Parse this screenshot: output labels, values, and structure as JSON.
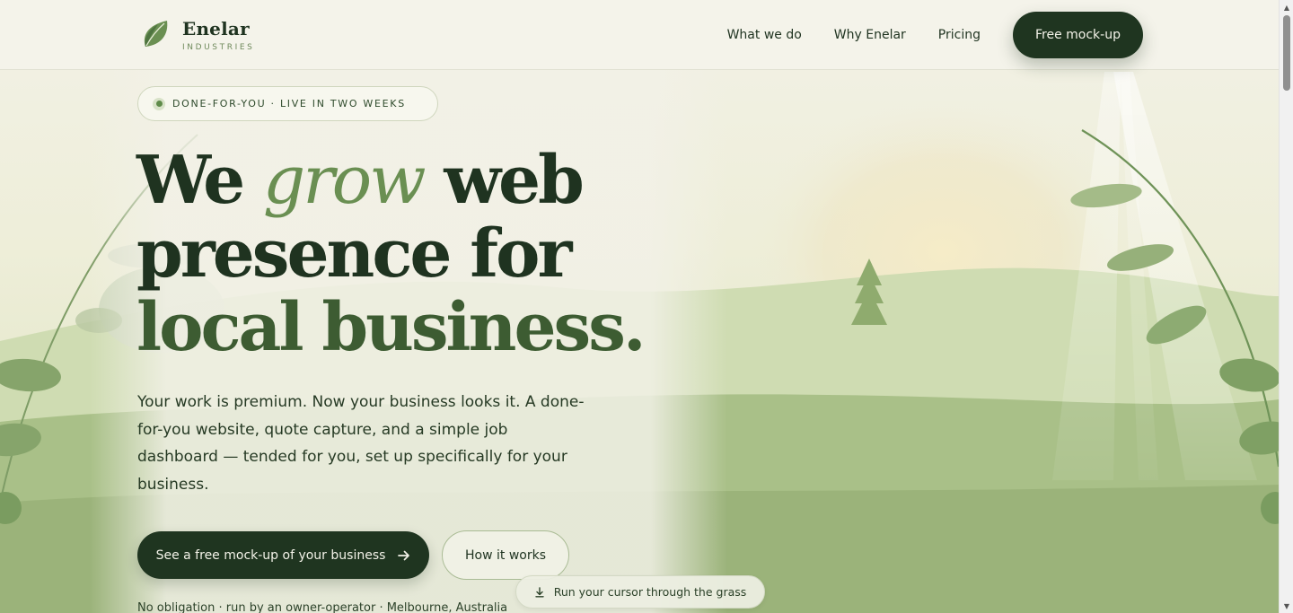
{
  "brand": {
    "name": "Enelar",
    "sub": "INDUSTRIES",
    "logo_icon": "leaf-icon"
  },
  "nav": {
    "links": [
      "What we do",
      "Why Enelar",
      "Pricing"
    ],
    "cta": "Free mock-up"
  },
  "hero": {
    "pill": "DONE-FOR-YOU · LIVE IN TWO WEEKS",
    "headline": {
      "part1": "We ",
      "accent": "grow",
      "part2": " web",
      "line2": "presence for",
      "line3": "local business."
    },
    "lede": "Your work is premium. Now your business looks it. A done-for-you website, quote capture, and a simple job dashboard — tended for you, set up specifically for your business.",
    "primary_cta": "See a free mock-up of your business",
    "primary_cta_icon": "arrow-right-icon",
    "secondary_cta": "How it works",
    "footnote": "No obligation · run by an owner-operator · Melbourne, Australia",
    "hint": "Run your cursor through the grass",
    "hint_icon": "download-icon"
  },
  "colors": {
    "brand_dark": "#1f3520",
    "accent_green": "#6a8f52",
    "background": "#f2f1e7",
    "meadow": "#9bb37a"
  }
}
